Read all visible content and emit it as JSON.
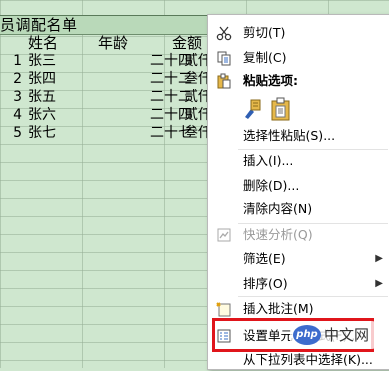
{
  "sheet": {
    "title": "员调配名单",
    "headers": {
      "name": "姓名",
      "age": "年龄",
      "amount": "金额"
    },
    "rows": [
      {
        "idx": "1",
        "name": "张三",
        "age": "二十四",
        "amount": "贰仟"
      },
      {
        "idx": "2",
        "name": "张四",
        "age": "二十二",
        "amount": "叁仟"
      },
      {
        "idx": "3",
        "name": "张五",
        "age": "二十二",
        "amount": "贰仟"
      },
      {
        "idx": "4",
        "name": "张六",
        "age": "二十四",
        "amount": "贰仟"
      },
      {
        "idx": "5",
        "name": "张七",
        "age": "二十七",
        "amount": "叁仟"
      }
    ]
  },
  "menu": {
    "cut": "剪切(T)",
    "copy": "复制(C)",
    "paste_options": "粘贴选项:",
    "paste_special": "选择性粘贴(S)...",
    "insert": "插入(I)...",
    "delete": "删除(D)...",
    "clear": "清除内容(N)",
    "quick_analysis": "快速分析(Q)",
    "filter": "筛选(E)",
    "sort": "排序(O)",
    "insert_comment": "插入批注(M)",
    "format_cells": "设置单元格格式(F)...",
    "pick_from_list": "从下拉列表中选择(K)..."
  },
  "watermark": {
    "logo": "php",
    "text": "中文网"
  },
  "colors": {
    "sheet_bg": "#cfe7cf",
    "highlight": "#e0151b"
  }
}
